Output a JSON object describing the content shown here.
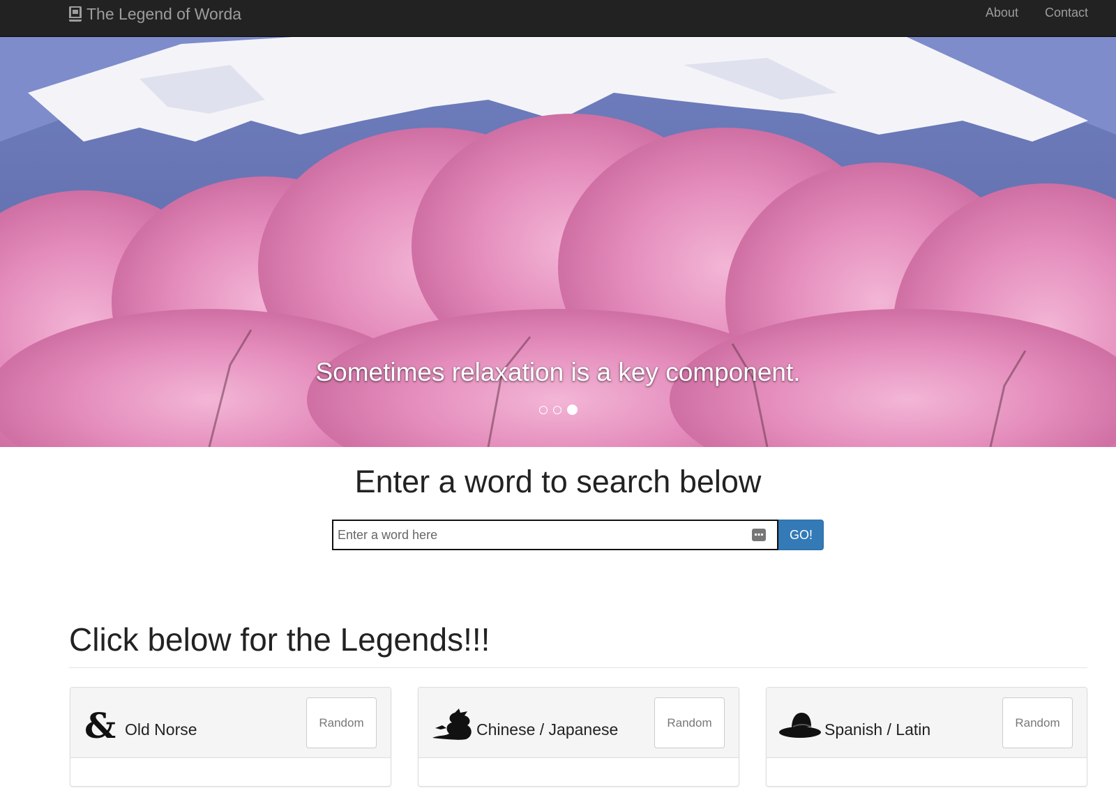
{
  "navbar": {
    "brand": "The Legend of Worda",
    "links": [
      {
        "label": "About"
      },
      {
        "label": "Contact"
      }
    ]
  },
  "hero": {
    "caption": "Sometimes relaxation is a key component.",
    "slide_count": 3,
    "active_slide": 3
  },
  "search": {
    "heading": "Enter a word to search below",
    "placeholder": "Enter a word here",
    "value": "",
    "button_label": "GO!"
  },
  "legends": {
    "heading": "Click below for the Legends!!!",
    "cards": [
      {
        "title": "Old Norse",
        "icon": "ampersand-dragon-icon",
        "button": "Random"
      },
      {
        "title": "Chinese / Japanese",
        "icon": "dragon-icon",
        "button": "Random"
      },
      {
        "title": "Spanish / Latin",
        "icon": "sombrero-hat-icon",
        "button": "Random"
      }
    ]
  },
  "colors": {
    "navbar_bg": "#222222",
    "nav_text": "#9d9d9d",
    "primary_button": "#337ab7",
    "blossom_pink": "#e98fbf",
    "sky_blue": "#7f8fc8"
  }
}
